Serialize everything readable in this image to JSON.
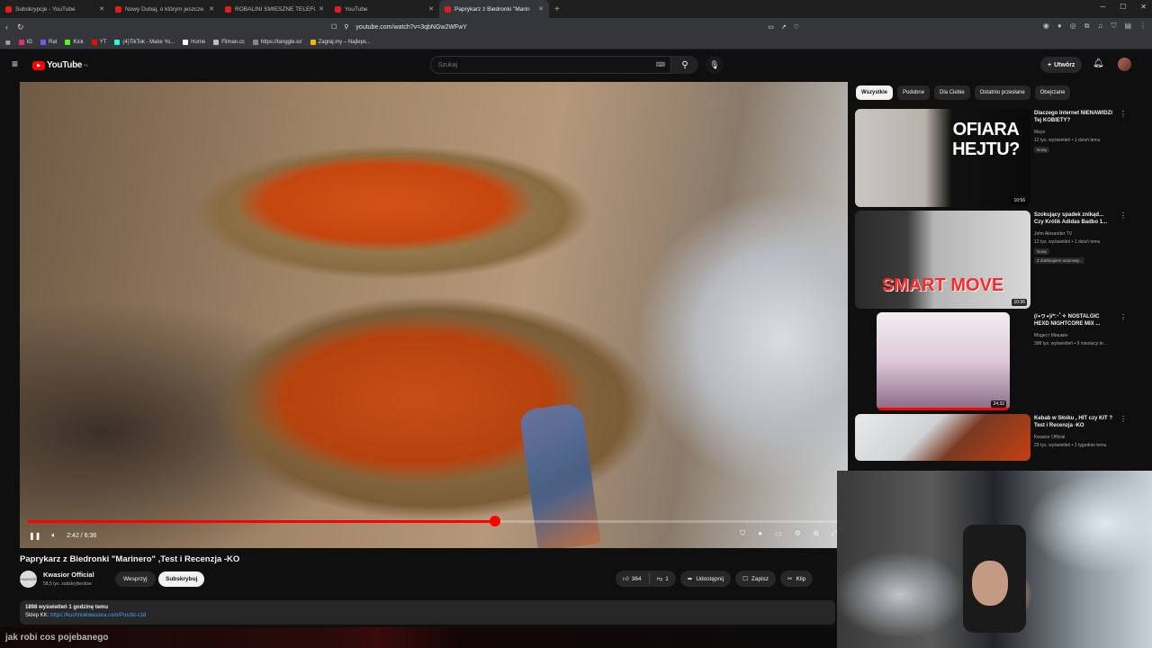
{
  "browser": {
    "tabs": [
      {
        "label": "Subskrypcje - YouTube",
        "active": false
      },
      {
        "label": "Nowy Dubaj, o którym jeszcze nie sł",
        "active": false
      },
      {
        "label": "ROBALINI ŚMIESZNE TELEFONY",
        "active": false
      },
      {
        "label": "YouTube",
        "active": false
      },
      {
        "label": "Paprykarz z Biedronki \"Marin",
        "active": true
      }
    ],
    "url": "youtube.com/watch?v=3qbNGw2WFwY",
    "bookmarks": [
      "IG",
      "Rat",
      "Kick",
      "YT",
      "(4)TikTok - Make Yo...",
      "Home",
      "Filman.cc",
      "https://tanggle.io/",
      "Zagraj.my – Najleps..."
    ]
  },
  "youtube": {
    "logo": "YouTube",
    "region": "PL",
    "search_placeholder": "Szukaj",
    "create_label": "Utwórz"
  },
  "player": {
    "time": "2:42 / 6:36",
    "progress_fraction": 0.575
  },
  "video": {
    "title": "Paprykarz z Biedronki \"Marinero\" ,Test i Recenzja -KO",
    "channel": "Kwasior Official",
    "channel_avatar_text": "KWASIOR",
    "subscribers": "58,5 tys. subskrybentów",
    "support_label": "Wesprzyj",
    "subscribe_label": "Subskrybuj",
    "likes": "364",
    "dislikes": "1",
    "share_label": "Udostępnij",
    "save_label": "Zapisz",
    "clip_label": "Klip",
    "desc_line1": "1898 wyświetleń  1 godzinę temu",
    "desc_prefix": "Sklep KK: ",
    "desc_link": "https://kuchniakwasiora.com/Puszki-c18"
  },
  "chips": [
    "Wszystkie",
    "Podobne",
    "Dla Ciebie",
    "Ostatnio przesłane",
    "Obejrzane"
  ],
  "recommendations": [
    {
      "title": "Dlaczego Internet NIENAWIDZI Tej KOBIETY?",
      "channel": "Mayo",
      "meta": "12 tys. wyświetleń • 1 dzień temu",
      "badge": "Nowy",
      "duration": "10:56",
      "thumb_text": "OFIARA HEJTU?"
    },
    {
      "title": "Szokujący spadek znikąd... Czy Królik Adidas Badbo 1...",
      "channel": "John Alexander TV",
      "meta": "12 tys. wyświetleń • 1 dzień temu",
      "badge": "Nowy",
      "badge2": "Z dubbingiem automaty...",
      "duration": "10:36",
      "thumb_text": "SMART MOVE"
    },
    {
      "title": "(/◕ヮ◕)/*:･ﾟ✧ NOSTALGIC HEXD NIGHTCORE MIX ...",
      "channel": "Модест Мишкин",
      "meta": "398 tys. wyświetleń • 9 miesięcy te...",
      "duration": "24:32"
    },
    {
      "title": "Kebab w Słoiku , HIT czy KIT ? Test i Recenzja -KO",
      "channel": "Kwasior Official",
      "meta": "29 tys. wyświetleń • 2 tygodnie temu"
    }
  ],
  "stream_overlay": "jak robi cos pojebanego"
}
